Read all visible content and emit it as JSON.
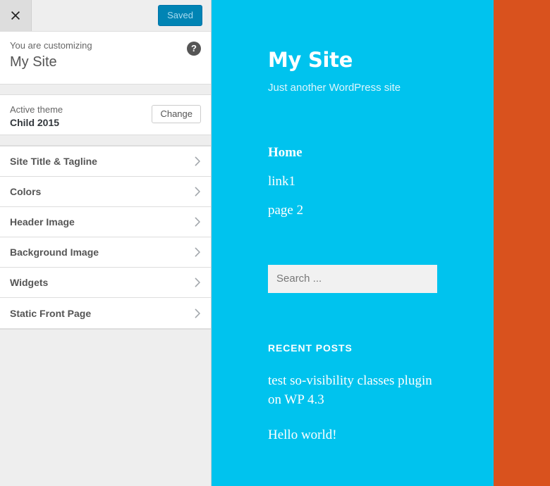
{
  "customizer": {
    "close_label": "Close",
    "save_button": "Saved",
    "info_label": "You are customizing",
    "info_title": "My Site",
    "help_glyph": "?",
    "theme": {
      "label": "Active theme",
      "name": "Child 2015",
      "change_button": "Change"
    },
    "panels": [
      {
        "label": "Site Title & Tagline"
      },
      {
        "label": "Colors"
      },
      {
        "label": "Header Image"
      },
      {
        "label": "Background Image"
      },
      {
        "label": "Widgets"
      },
      {
        "label": "Static Front Page"
      }
    ]
  },
  "preview": {
    "site_title": "My Site",
    "site_description": "Just another WordPress site",
    "nav": [
      {
        "label": "Home",
        "current": true
      },
      {
        "label": "link1",
        "current": false
      },
      {
        "label": "page 2",
        "current": false
      }
    ],
    "search": {
      "placeholder": "Search ...",
      "value": ""
    },
    "recent_posts": {
      "title": "Recent Posts",
      "items": [
        {
          "label": "test so-visibility classes plugin on WP 4.3"
        },
        {
          "label": "Hello world!"
        }
      ]
    },
    "colors": {
      "sidebar_background": "#00c3ee",
      "content_background": "#d9521e",
      "accent_button": "#0084b4"
    }
  }
}
